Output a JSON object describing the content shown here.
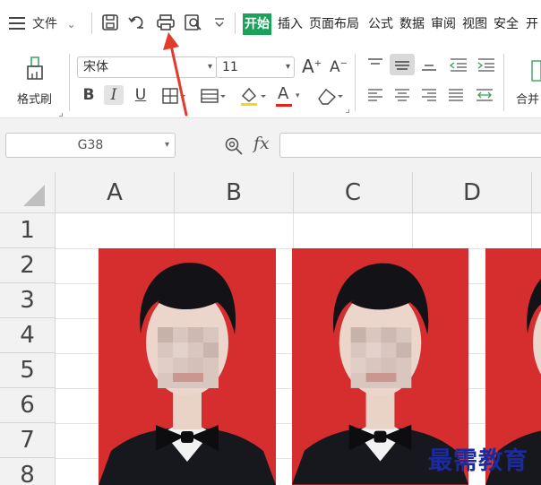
{
  "menubar": {
    "menu_label": "文件",
    "tabs": [
      {
        "label": "开始",
        "active": true
      },
      {
        "label": "插入"
      },
      {
        "label": "页面布局"
      },
      {
        "label": "公式"
      },
      {
        "label": "数据"
      },
      {
        "label": "审阅"
      },
      {
        "label": "视图"
      },
      {
        "label": "安全"
      },
      {
        "label": "开"
      }
    ],
    "accent_color": "#1aa25a"
  },
  "ribbon": {
    "format_painter_label": "格式刷",
    "font_name": "宋体",
    "font_size": "11",
    "bold_label": "B",
    "italic_label": "I",
    "underline_label": "U",
    "grow_font_label": "A",
    "shrink_font_label": "A",
    "font_color_label": "A",
    "merge_label": "合并"
  },
  "formula_bar": {
    "name_box": "G38",
    "fx_label": "fx",
    "formula_value": ""
  },
  "sheet": {
    "columns": [
      "A",
      "B",
      "C",
      "D"
    ],
    "rows": [
      "1",
      "2",
      "3",
      "4",
      "5",
      "6",
      "7",
      "8"
    ]
  },
  "watermark": "最需教育",
  "colors": {
    "photo_background": "#d62d2f",
    "annotation_arrow": "#e23b2e",
    "watermark": "#1b2b9e"
  }
}
